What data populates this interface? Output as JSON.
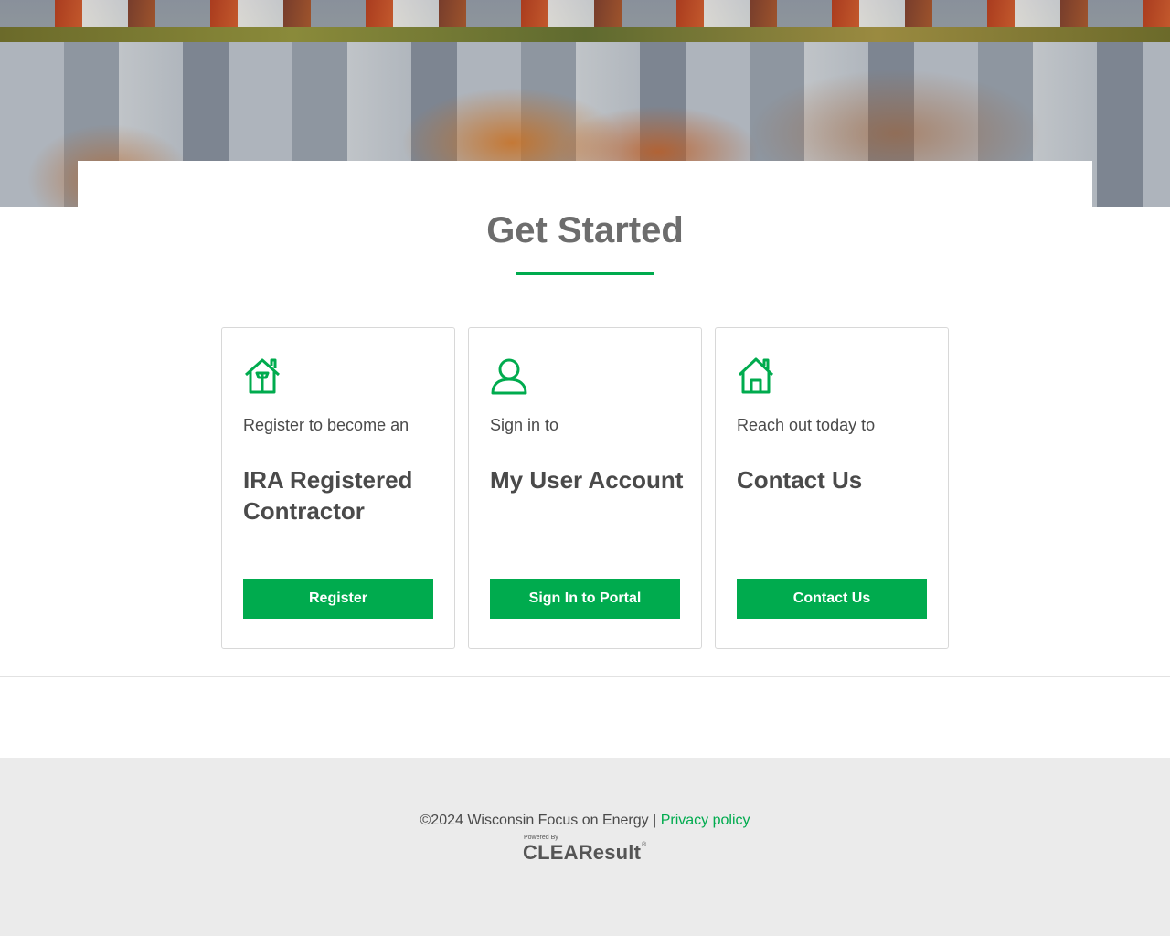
{
  "hero": {
    "image_alt": ""
  },
  "heading": "Get Started",
  "cards": [
    {
      "icon": "house-tools-icon",
      "lead": "Register to become an",
      "title": "IRA Registered Contractor",
      "button": "Register"
    },
    {
      "icon": "user-icon",
      "lead": "Sign in to",
      "title": "My User Account",
      "button": "Sign In to Portal"
    },
    {
      "icon": "house-icon",
      "lead": "Reach out today to",
      "title": "Contact Us",
      "button": "Contact Us"
    }
  ],
  "footer": {
    "copyright": "©2024 Wisconsin Focus on Energy | ",
    "privacy_link": "Privacy policy",
    "powered_by": "Powered By",
    "brand": "CLEAResult",
    "brand_mark": "®"
  },
  "colors": {
    "accent": "#00ab4e",
    "heading": "#6d6d6d",
    "footer_bg": "#ebebeb"
  }
}
